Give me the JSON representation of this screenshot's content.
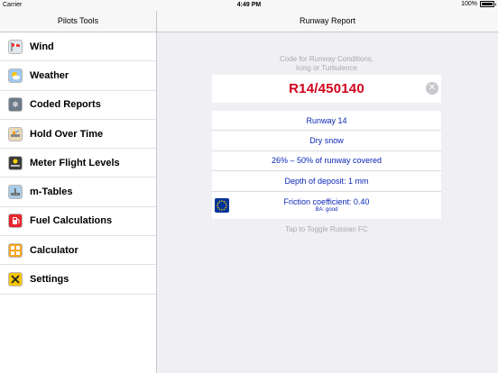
{
  "status": {
    "carrier": "Carrier",
    "time": "4:49 PM",
    "battery": "100%"
  },
  "sidebar": {
    "title": "Pilots Tools",
    "items": [
      {
        "label": "Wind",
        "icon": "windsock-icon"
      },
      {
        "label": "Weather",
        "icon": "weather-icon"
      },
      {
        "label": "Coded Reports",
        "icon": "snowflake-icon"
      },
      {
        "label": "Hold Over Time",
        "icon": "deicing-icon"
      },
      {
        "label": "Meter Flight Levels",
        "icon": "altitude-icon"
      },
      {
        "label": "m-Tables",
        "icon": "runway-icon"
      },
      {
        "label": "Fuel Calculations",
        "icon": "fuel-pump-icon"
      },
      {
        "label": "Calculator",
        "icon": "calculator-icon"
      },
      {
        "label": "Settings",
        "icon": "tools-icon"
      }
    ]
  },
  "main": {
    "title": "Runway Report",
    "hint_line1": "Code for Runway Conditions,",
    "hint_line2": "Icing or Turbulence",
    "code": "R14/450140",
    "clear_symbol": "✕",
    "results": {
      "runway": "Runway 14",
      "deposit": "Dry snow",
      "coverage": "26% – 50% of runway covered",
      "depth": "Depth of deposit: 1 mm",
      "friction": "Friction coefficient: 0.40",
      "braking": "BA: good"
    },
    "toggle_hint": "Tap to Toggle Russian FC"
  },
  "colors": {
    "code": "#d0021b",
    "result_text": "#0b26b8",
    "background": "#efeff4"
  }
}
